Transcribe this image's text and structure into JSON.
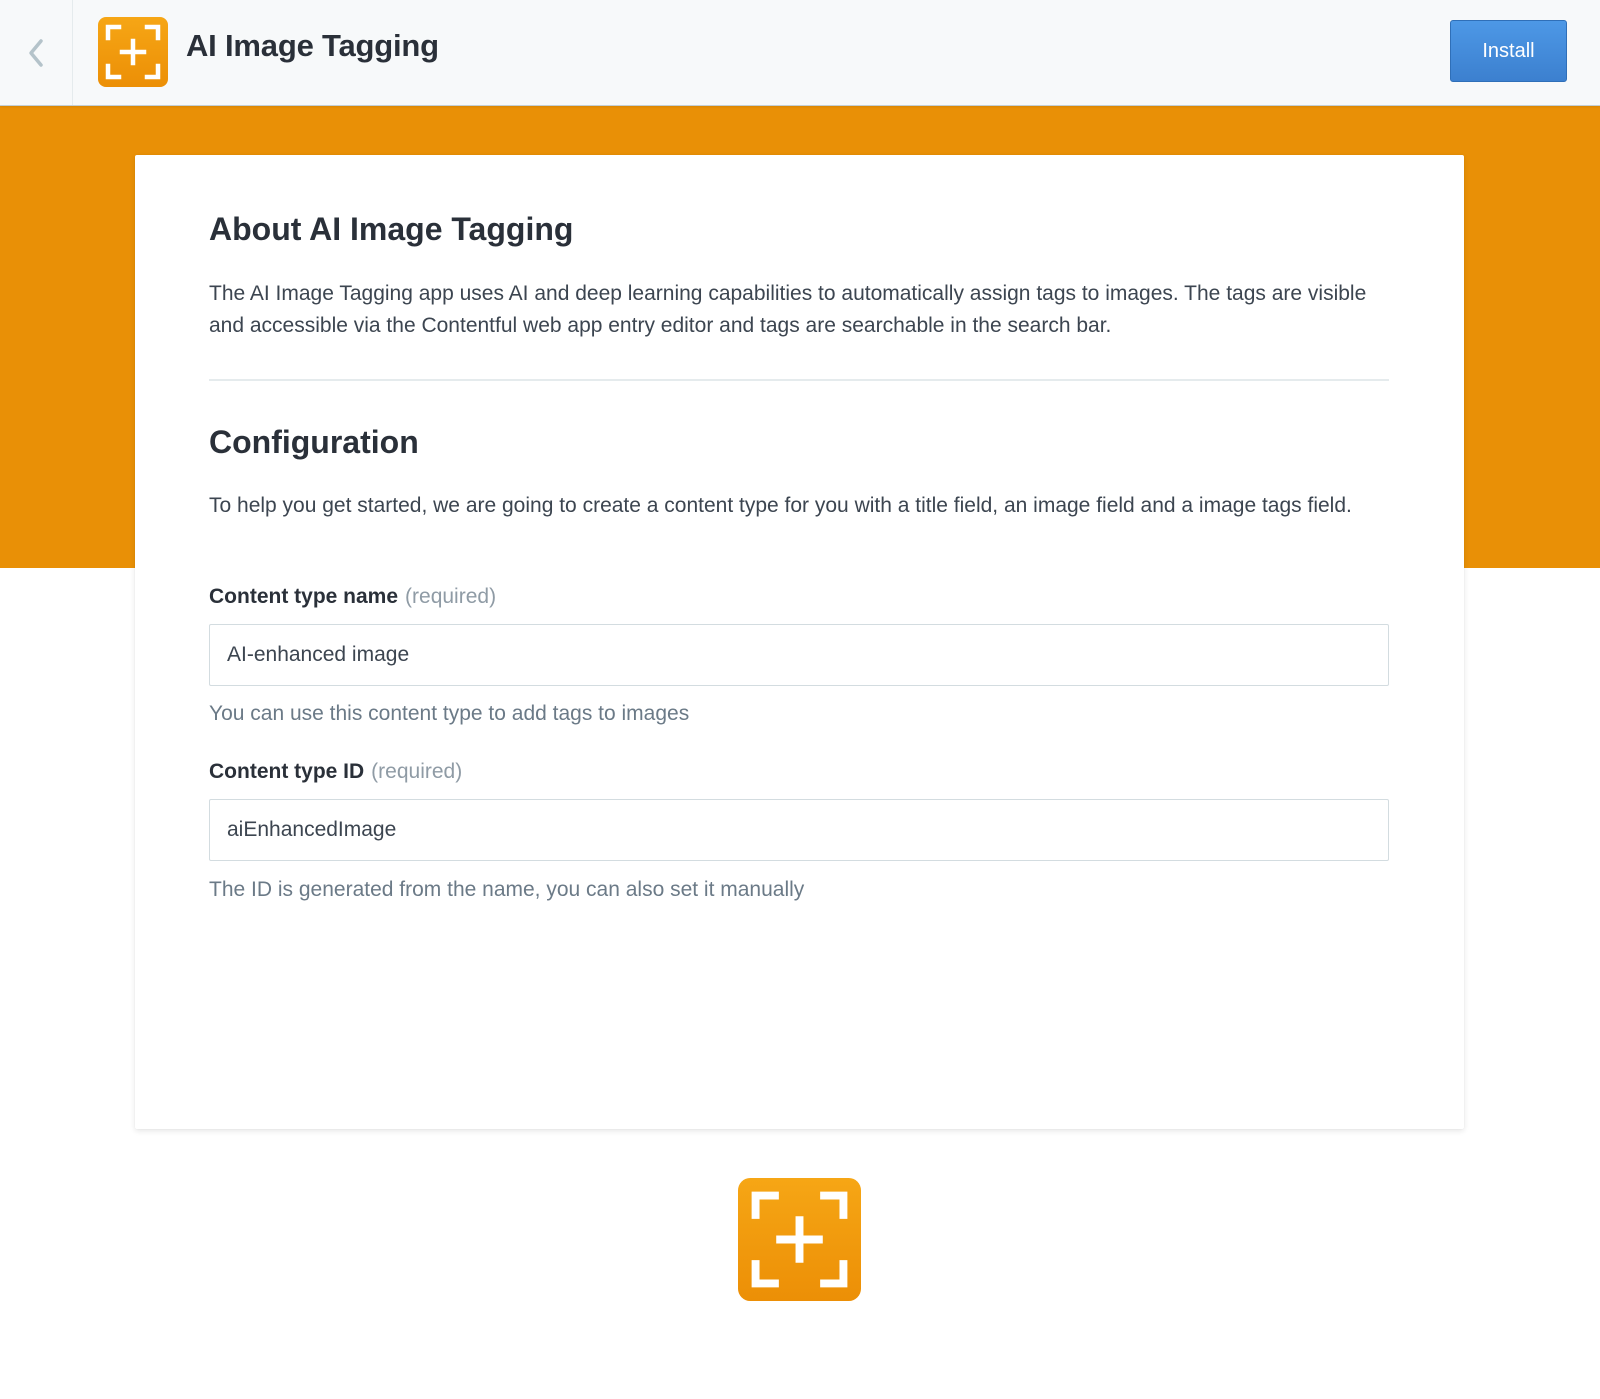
{
  "header": {
    "title": "AI Image Tagging",
    "install_label": "Install",
    "back_icon": "chevron-left-icon",
    "logo_icon": "focus-add-icon"
  },
  "colors": {
    "brand_orange": "#e99006",
    "primary_blue": "#3c80cf"
  },
  "about": {
    "heading": "About AI Image Tagging",
    "description": "The AI Image Tagging app uses AI and deep learning capabilities to automatically assign tags to images. The tags are visible and accessible via the Contentful web app entry editor and tags are searchable in the search bar."
  },
  "configuration": {
    "heading": "Configuration",
    "description": "To help you get started, we are going to create a content type for you with a title field, an image field and a image tags field.",
    "fields": [
      {
        "label": "Content type name",
        "required_text": "(required)",
        "value": "AI-enhanced image",
        "help": "You can use this content type to add tags to images"
      },
      {
        "label": "Content type ID",
        "required_text": "(required)",
        "value": "aiEnhancedImage",
        "help": "The ID is generated from the name, you can also set it manually"
      }
    ]
  },
  "footer": {
    "logo_icon": "focus-add-icon"
  }
}
